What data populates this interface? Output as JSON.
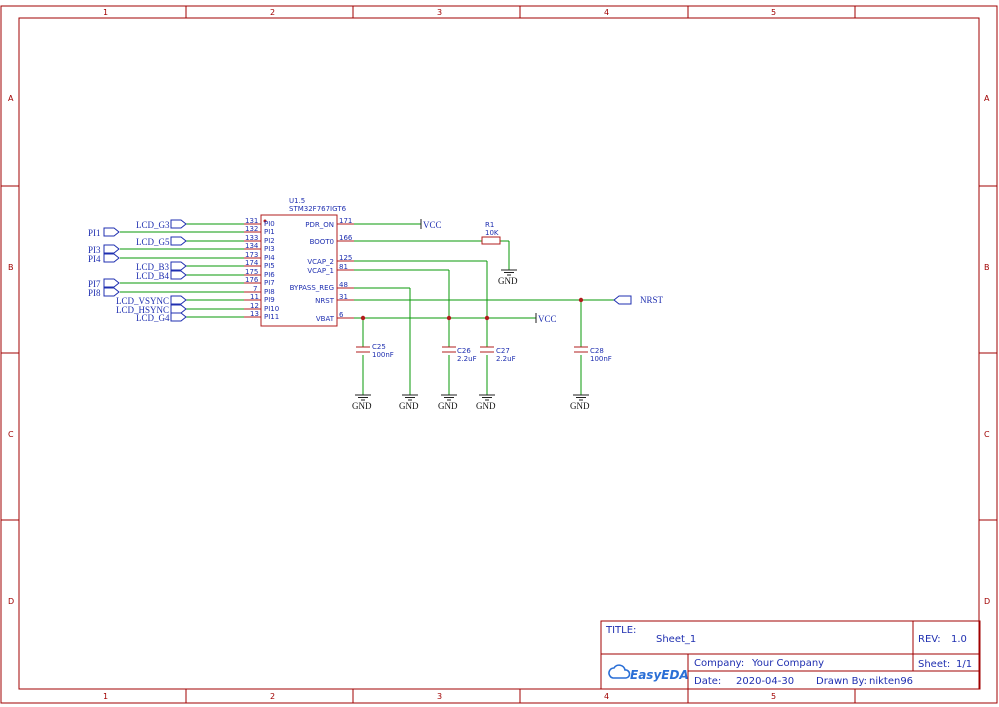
{
  "frame": {
    "columns": [
      "1",
      "2",
      "3",
      "4",
      "5"
    ],
    "rows": [
      "A",
      "B",
      "C",
      "D"
    ]
  },
  "component": {
    "ref": "U1.5",
    "part": "STM32F767IGT6",
    "left_pins": [
      {
        "num": "131",
        "name": "PI0"
      },
      {
        "num": "132",
        "name": "PI1"
      },
      {
        "num": "133",
        "name": "PI2"
      },
      {
        "num": "134",
        "name": "PI3"
      },
      {
        "num": "173",
        "name": "PI4"
      },
      {
        "num": "174",
        "name": "PI5"
      },
      {
        "num": "175",
        "name": "PI6"
      },
      {
        "num": "176",
        "name": "PI7"
      },
      {
        "num": "7",
        "name": "PI8"
      },
      {
        "num": "11",
        "name": "PI9"
      },
      {
        "num": "12",
        "name": "PI10"
      },
      {
        "num": "13",
        "name": "PI11"
      }
    ],
    "right_pins": [
      {
        "num": "171",
        "name": "PDR_ON"
      },
      {
        "num": "166",
        "name": "BOOT0"
      },
      {
        "num": "125",
        "name": "VCAP_2"
      },
      {
        "num": "81",
        "name": "VCAP_1"
      },
      {
        "num": "48",
        "name": "BYPASS_REG"
      },
      {
        "num": "31",
        "name": "NRST"
      },
      {
        "num": "6",
        "name": "VBAT"
      }
    ]
  },
  "nets": {
    "lcd_g3": "LCD_G3",
    "pi1": "PI1",
    "lcd_g5": "LCD_G5",
    "pi3": "PI3",
    "pi4": "PI4",
    "lcd_b3": "LCD_B3",
    "lcd_b4": "LCD_B4",
    "pi7": "PI7",
    "pi8": "PI8",
    "lcd_vsync": "LCD_VSYNC",
    "lcd_hsync": "LCD_HSYNC",
    "lcd_g4": "LCD_G4",
    "vcc1": "VCC",
    "vcc2": "VCC",
    "nrst": "NRST"
  },
  "r1": {
    "ref": "R1",
    "value": "10K"
  },
  "caps": [
    {
      "ref": "C25",
      "value": "100nF"
    },
    {
      "ref": "C26",
      "value": "2.2uF"
    },
    {
      "ref": "C27",
      "value": "2.2uF"
    },
    {
      "ref": "C28",
      "value": "100nF"
    }
  ],
  "gnd_label": "GND",
  "title_block": {
    "title_label": "TITLE:",
    "title": "Sheet_1",
    "rev_label": "REV:",
    "rev": "1.0",
    "company_label": "Company:",
    "company": "Your Company",
    "sheet_label": "Sheet:",
    "sheet": "1/1",
    "date_label": "Date:",
    "date": "2020-04-30",
    "drawn_label": "Drawn By:",
    "drawn_by": "nikten96",
    "logo": "EasyEDA"
  },
  "colors": {
    "frame": "#a00000",
    "wire": "#0a9a0a",
    "text": "#1f2fb0"
  }
}
